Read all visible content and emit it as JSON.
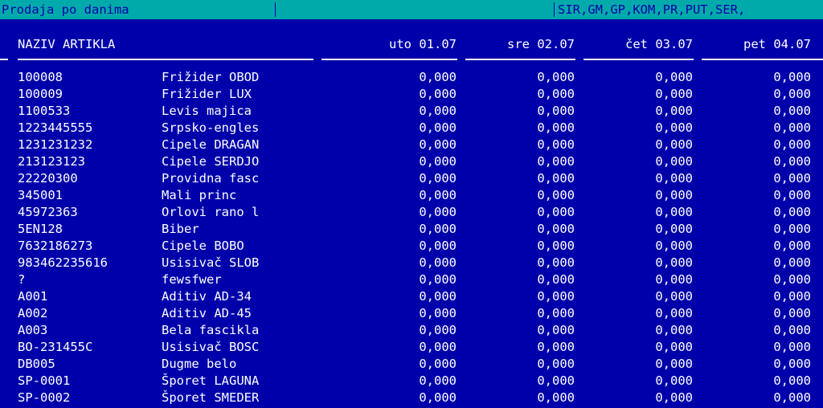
{
  "title_bar": {
    "title": "Prodaja po danima",
    "filters": "SIR,GM,GP,KOM,PR,PUT,SER,"
  },
  "table": {
    "columns": {
      "name": "NAZIV ARTIKLA",
      "days": [
        "uto 01.07",
        "sre 02.07",
        "čet 03.07",
        "pet 04.07"
      ]
    },
    "rows": [
      {
        "code": "100008",
        "name": "Frižider OBOD",
        "values": [
          "0,000",
          "0,000",
          "0,000",
          "0,000"
        ]
      },
      {
        "code": "100009",
        "name": "Frižider LUX",
        "values": [
          "0,000",
          "0,000",
          "0,000",
          "0,000"
        ]
      },
      {
        "code": "1100533",
        "name": "Levis majica",
        "values": [
          "0,000",
          "0,000",
          "0,000",
          "0,000"
        ]
      },
      {
        "code": "1223445555",
        "name": "Srpsko-engles",
        "values": [
          "0,000",
          "0,000",
          "0,000",
          "0,000"
        ]
      },
      {
        "code": "1231231232",
        "name": "Cipele DRAGAN",
        "values": [
          "0,000",
          "0,000",
          "0,000",
          "0,000"
        ]
      },
      {
        "code": "213123123",
        "name": "Cipele SERDJO",
        "values": [
          "0,000",
          "0,000",
          "0,000",
          "0,000"
        ]
      },
      {
        "code": "22220300",
        "name": "Providna fasc",
        "values": [
          "0,000",
          "0,000",
          "0,000",
          "0,000"
        ]
      },
      {
        "code": "345001",
        "name": "Mali princ",
        "values": [
          "0,000",
          "0,000",
          "0,000",
          "0,000"
        ]
      },
      {
        "code": "45972363",
        "name": "Orlovi rano l",
        "values": [
          "0,000",
          "0,000",
          "0,000",
          "0,000"
        ]
      },
      {
        "code": "5EN128",
        "name": "Biber",
        "values": [
          "0,000",
          "0,000",
          "0,000",
          "0,000"
        ]
      },
      {
        "code": "7632186273",
        "name": "Cipele BOBO",
        "values": [
          "0,000",
          "0,000",
          "0,000",
          "0,000"
        ]
      },
      {
        "code": "983462235616",
        "name": "Usisivač SLOB",
        "values": [
          "0,000",
          "0,000",
          "0,000",
          "0,000"
        ]
      },
      {
        "code": "?",
        "name": "fewsfwer",
        "values": [
          "0,000",
          "0,000",
          "0,000",
          "0,000"
        ]
      },
      {
        "code": "A001",
        "name": "Aditiv AD-34",
        "values": [
          "0,000",
          "0,000",
          "0,000",
          "0,000"
        ]
      },
      {
        "code": "A002",
        "name": "Aditiv AD-45",
        "values": [
          "0,000",
          "0,000",
          "0,000",
          "0,000"
        ]
      },
      {
        "code": "A003",
        "name": "Bela fascikla",
        "values": [
          "0,000",
          "0,000",
          "0,000",
          "0,000"
        ]
      },
      {
        "code": "BO-231455C",
        "name": "Usisivač BOSC",
        "values": [
          "0,000",
          "0,000",
          "0,000",
          "0,000"
        ]
      },
      {
        "code": "DB005",
        "name": "Dugme belo",
        "values": [
          "0,000",
          "0,000",
          "0,000",
          "0,000"
        ]
      },
      {
        "code": "SP-0001",
        "name": "Šporet LAGUNA",
        "values": [
          "0,000",
          "0,000",
          "0,000",
          "0,000"
        ]
      },
      {
        "code": "SP-0002",
        "name": "Šporet SMEDER",
        "values": [
          "0,000",
          "0,000",
          "0,000",
          "0,000"
        ]
      }
    ]
  },
  "colors": {
    "background": "#0000aa",
    "title_bar": "#00aaaa",
    "text": "#ffffff"
  }
}
